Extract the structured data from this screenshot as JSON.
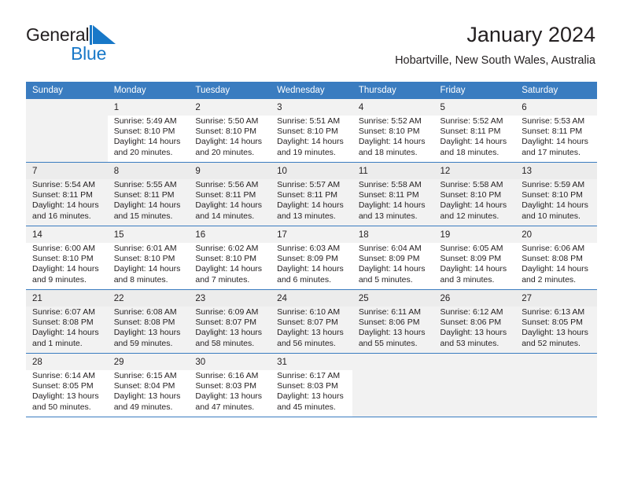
{
  "brand": {
    "name_part1": "General",
    "name_part2": "Blue",
    "logo_icon": "triangle-flag-icon",
    "color_primary": "#1878c8",
    "color_text": "#231f20"
  },
  "header": {
    "title": "January 2024",
    "subtitle": "Hobartville, New South Wales, Australia"
  },
  "calendar": {
    "header_bg": "#3a7cc0",
    "header_text_color": "#ffffff",
    "weekdays": [
      "Sunday",
      "Monday",
      "Tuesday",
      "Wednesday",
      "Thursday",
      "Friday",
      "Saturday"
    ],
    "weeks": [
      {
        "shaded": false,
        "days": [
          {
            "num": "",
            "sunrise": "",
            "sunset": "",
            "daylight_1": "",
            "daylight_2": "",
            "empty": true
          },
          {
            "num": "1",
            "sunrise": "Sunrise: 5:49 AM",
            "sunset": "Sunset: 8:10 PM",
            "daylight_1": "Daylight: 14 hours",
            "daylight_2": "and 20 minutes."
          },
          {
            "num": "2",
            "sunrise": "Sunrise: 5:50 AM",
            "sunset": "Sunset: 8:10 PM",
            "daylight_1": "Daylight: 14 hours",
            "daylight_2": "and 20 minutes."
          },
          {
            "num": "3",
            "sunrise": "Sunrise: 5:51 AM",
            "sunset": "Sunset: 8:10 PM",
            "daylight_1": "Daylight: 14 hours",
            "daylight_2": "and 19 minutes."
          },
          {
            "num": "4",
            "sunrise": "Sunrise: 5:52 AM",
            "sunset": "Sunset: 8:10 PM",
            "daylight_1": "Daylight: 14 hours",
            "daylight_2": "and 18 minutes."
          },
          {
            "num": "5",
            "sunrise": "Sunrise: 5:52 AM",
            "sunset": "Sunset: 8:11 PM",
            "daylight_1": "Daylight: 14 hours",
            "daylight_2": "and 18 minutes."
          },
          {
            "num": "6",
            "sunrise": "Sunrise: 5:53 AM",
            "sunset": "Sunset: 8:11 PM",
            "daylight_1": "Daylight: 14 hours",
            "daylight_2": "and 17 minutes."
          }
        ]
      },
      {
        "shaded": true,
        "days": [
          {
            "num": "7",
            "sunrise": "Sunrise: 5:54 AM",
            "sunset": "Sunset: 8:11 PM",
            "daylight_1": "Daylight: 14 hours",
            "daylight_2": "and 16 minutes."
          },
          {
            "num": "8",
            "sunrise": "Sunrise: 5:55 AM",
            "sunset": "Sunset: 8:11 PM",
            "daylight_1": "Daylight: 14 hours",
            "daylight_2": "and 15 minutes."
          },
          {
            "num": "9",
            "sunrise": "Sunrise: 5:56 AM",
            "sunset": "Sunset: 8:11 PM",
            "daylight_1": "Daylight: 14 hours",
            "daylight_2": "and 14 minutes."
          },
          {
            "num": "10",
            "sunrise": "Sunrise: 5:57 AM",
            "sunset": "Sunset: 8:11 PM",
            "daylight_1": "Daylight: 14 hours",
            "daylight_2": "and 13 minutes."
          },
          {
            "num": "11",
            "sunrise": "Sunrise: 5:58 AM",
            "sunset": "Sunset: 8:11 PM",
            "daylight_1": "Daylight: 14 hours",
            "daylight_2": "and 13 minutes."
          },
          {
            "num": "12",
            "sunrise": "Sunrise: 5:58 AM",
            "sunset": "Sunset: 8:10 PM",
            "daylight_1": "Daylight: 14 hours",
            "daylight_2": "and 12 minutes."
          },
          {
            "num": "13",
            "sunrise": "Sunrise: 5:59 AM",
            "sunset": "Sunset: 8:10 PM",
            "daylight_1": "Daylight: 14 hours",
            "daylight_2": "and 10 minutes."
          }
        ]
      },
      {
        "shaded": false,
        "days": [
          {
            "num": "14",
            "sunrise": "Sunrise: 6:00 AM",
            "sunset": "Sunset: 8:10 PM",
            "daylight_1": "Daylight: 14 hours",
            "daylight_2": "and 9 minutes."
          },
          {
            "num": "15",
            "sunrise": "Sunrise: 6:01 AM",
            "sunset": "Sunset: 8:10 PM",
            "daylight_1": "Daylight: 14 hours",
            "daylight_2": "and 8 minutes."
          },
          {
            "num": "16",
            "sunrise": "Sunrise: 6:02 AM",
            "sunset": "Sunset: 8:10 PM",
            "daylight_1": "Daylight: 14 hours",
            "daylight_2": "and 7 minutes."
          },
          {
            "num": "17",
            "sunrise": "Sunrise: 6:03 AM",
            "sunset": "Sunset: 8:09 PM",
            "daylight_1": "Daylight: 14 hours",
            "daylight_2": "and 6 minutes."
          },
          {
            "num": "18",
            "sunrise": "Sunrise: 6:04 AM",
            "sunset": "Sunset: 8:09 PM",
            "daylight_1": "Daylight: 14 hours",
            "daylight_2": "and 5 minutes."
          },
          {
            "num": "19",
            "sunrise": "Sunrise: 6:05 AM",
            "sunset": "Sunset: 8:09 PM",
            "daylight_1": "Daylight: 14 hours",
            "daylight_2": "and 3 minutes."
          },
          {
            "num": "20",
            "sunrise": "Sunrise: 6:06 AM",
            "sunset": "Sunset: 8:08 PM",
            "daylight_1": "Daylight: 14 hours",
            "daylight_2": "and 2 minutes."
          }
        ]
      },
      {
        "shaded": true,
        "days": [
          {
            "num": "21",
            "sunrise": "Sunrise: 6:07 AM",
            "sunset": "Sunset: 8:08 PM",
            "daylight_1": "Daylight: 14 hours",
            "daylight_2": "and 1 minute."
          },
          {
            "num": "22",
            "sunrise": "Sunrise: 6:08 AM",
            "sunset": "Sunset: 8:08 PM",
            "daylight_1": "Daylight: 13 hours",
            "daylight_2": "and 59 minutes."
          },
          {
            "num": "23",
            "sunrise": "Sunrise: 6:09 AM",
            "sunset": "Sunset: 8:07 PM",
            "daylight_1": "Daylight: 13 hours",
            "daylight_2": "and 58 minutes."
          },
          {
            "num": "24",
            "sunrise": "Sunrise: 6:10 AM",
            "sunset": "Sunset: 8:07 PM",
            "daylight_1": "Daylight: 13 hours",
            "daylight_2": "and 56 minutes."
          },
          {
            "num": "25",
            "sunrise": "Sunrise: 6:11 AM",
            "sunset": "Sunset: 8:06 PM",
            "daylight_1": "Daylight: 13 hours",
            "daylight_2": "and 55 minutes."
          },
          {
            "num": "26",
            "sunrise": "Sunrise: 6:12 AM",
            "sunset": "Sunset: 8:06 PM",
            "daylight_1": "Daylight: 13 hours",
            "daylight_2": "and 53 minutes."
          },
          {
            "num": "27",
            "sunrise": "Sunrise: 6:13 AM",
            "sunset": "Sunset: 8:05 PM",
            "daylight_1": "Daylight: 13 hours",
            "daylight_2": "and 52 minutes."
          }
        ]
      },
      {
        "shaded": false,
        "days": [
          {
            "num": "28",
            "sunrise": "Sunrise: 6:14 AM",
            "sunset": "Sunset: 8:05 PM",
            "daylight_1": "Daylight: 13 hours",
            "daylight_2": "and 50 minutes."
          },
          {
            "num": "29",
            "sunrise": "Sunrise: 6:15 AM",
            "sunset": "Sunset: 8:04 PM",
            "daylight_1": "Daylight: 13 hours",
            "daylight_2": "and 49 minutes."
          },
          {
            "num": "30",
            "sunrise": "Sunrise: 6:16 AM",
            "sunset": "Sunset: 8:03 PM",
            "daylight_1": "Daylight: 13 hours",
            "daylight_2": "and 47 minutes."
          },
          {
            "num": "31",
            "sunrise": "Sunrise: 6:17 AM",
            "sunset": "Sunset: 8:03 PM",
            "daylight_1": "Daylight: 13 hours",
            "daylight_2": "and 45 minutes."
          },
          {
            "num": "",
            "sunrise": "",
            "sunset": "",
            "daylight_1": "",
            "daylight_2": "",
            "empty": true
          },
          {
            "num": "",
            "sunrise": "",
            "sunset": "",
            "daylight_1": "",
            "daylight_2": "",
            "empty": true
          },
          {
            "num": "",
            "sunrise": "",
            "sunset": "",
            "daylight_1": "",
            "daylight_2": "",
            "empty": true
          }
        ]
      }
    ]
  }
}
